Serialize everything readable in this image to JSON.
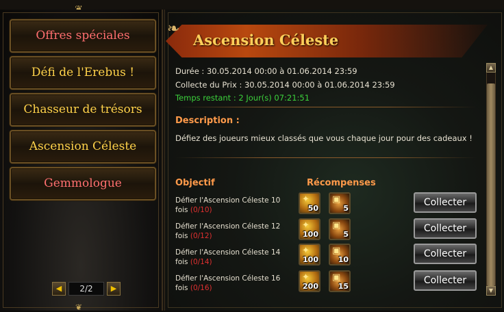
{
  "menu": {
    "items": [
      {
        "label": "Offres spéciales",
        "color": "#ff6f6f"
      },
      {
        "label": "Défi de l'Erebus !",
        "color": "#ffd24a"
      },
      {
        "label": "Chasseur de trésors",
        "color": "#ffd24a"
      },
      {
        "label": "Ascension Céleste",
        "color": "#ffd24a"
      },
      {
        "label": "Gemmologue",
        "color": "#ff6f6f"
      }
    ],
    "pager": {
      "current": "2/2",
      "prev_icon": "arrow-left-icon",
      "next_icon": "arrow-right-icon"
    }
  },
  "event": {
    "title": "Ascension Céleste",
    "duration": "Durée : 30.05.2014 00:00 à 01.06.2014 23:59",
    "collect_period": "Collecte du Prix : 30.05.2014 00:00 à 01.06.2014 23:59",
    "time_left": "Temps restant : 2 Jour(s)  07:21:51",
    "description_title": "Description :",
    "description": "Défiez des joueurs mieux classés que vous chaque jour pour des cadeaux !",
    "objective_header": "Objectif",
    "rewards_header": "Récompenses",
    "objectives": [
      {
        "text": "Défier l'Ascension Céleste 10",
        "text2": "fois ",
        "progress": "(0/10)",
        "gem_qty": "50",
        "chest_qty": "5",
        "button": "Collecter"
      },
      {
        "text": "Défier l'Ascension Céleste 12",
        "text2": "fois ",
        "progress": "(0/12)",
        "gem_qty": "100",
        "chest_qty": "5",
        "button": "Collecter"
      },
      {
        "text": "Défier l'Ascension Céleste 14",
        "text2": "fois ",
        "progress": "(0/14)",
        "gem_qty": "100",
        "chest_qty": "10",
        "button": "Collecter"
      },
      {
        "text": "Défier l'Ascension Céleste 16",
        "text2": "fois ",
        "progress": "(0/16)",
        "gem_qty": "200",
        "chest_qty": "15",
        "button": "Collecter"
      }
    ]
  },
  "colors": {
    "accent": "#ff9a4a",
    "title": "#ffcf5a",
    "time_left": "#3cd23c",
    "progress": "#e03030"
  }
}
